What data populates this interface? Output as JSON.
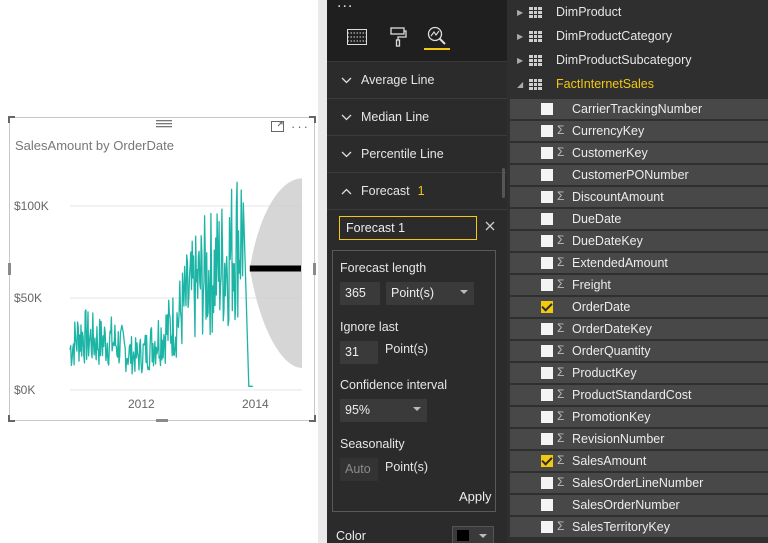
{
  "visual": {
    "title": "SalesAmount by OrderDate",
    "icons": [
      "focus-mode-icon",
      "more-options-icon"
    ]
  },
  "chart_data": {
    "type": "line",
    "title": "SalesAmount by OrderDate",
    "xlabel": "",
    "ylabel": "",
    "x_ticks": [
      "2012",
      "2014"
    ],
    "y_ticks": [
      "$0K",
      "$50K",
      "$100K"
    ],
    "ylim": [
      0,
      115000
    ],
    "series": [
      {
        "x": [
          "2011-01",
          "2011-03",
          "2011-05",
          "2011-07",
          "2011-09",
          "2011-11",
          "2012-01",
          "2012-03",
          "2012-05",
          "2012-07",
          "2012-09",
          "2012-11",
          "2013-01",
          "2013-03",
          "2013-05",
          "2013-07",
          "2013-09",
          "2013-11",
          "2014-01",
          "2014-02"
        ],
        "y": [
          22000,
          30000,
          28000,
          26000,
          27000,
          25000,
          20000,
          18000,
          22000,
          28000,
          32000,
          37000,
          48000,
          55000,
          62000,
          65000,
          70000,
          78000,
          90000,
          2000
        ]
      }
    ],
    "forecast": {
      "value": 66000,
      "confidence_upper": 115000,
      "confidence_lower": 12000
    },
    "colors": {
      "series": "#1cb5a5",
      "forecast": "#000000",
      "band": "#cfcfcf"
    }
  },
  "format_pane": {
    "more": "...",
    "tabs": [
      "fields-tab-icon",
      "format-paint-icon",
      "analytics-icon"
    ],
    "sections": [
      {
        "label": "Average Line"
      },
      {
        "label": "Median Line"
      },
      {
        "label": "Percentile Line"
      },
      {
        "label": "Forecast",
        "badge": "1"
      }
    ],
    "forecast": {
      "name": "Forecast 1",
      "length_label": "Forecast length",
      "length_value": "365",
      "length_unit": "Point(s)",
      "ignore_label": "Ignore last",
      "ignore_value": "31",
      "ignore_unit": "Point(s)",
      "ci_label": "Confidence interval",
      "ci_value": "95%",
      "seasonality_label": "Seasonality",
      "seasonality_value": "Auto",
      "seasonality_unit": "Point(s)",
      "apply": "Apply"
    },
    "color_label": "Color",
    "color_value": "#000000"
  },
  "fields_pane": {
    "tables": [
      {
        "name": "DimProduct"
      },
      {
        "name": "DimProductCategory"
      },
      {
        "name": "DimProductSubcategory"
      },
      {
        "name": "FactInternetSales"
      }
    ],
    "fields": [
      {
        "name": "CarrierTrackingNumber",
        "sigma": false,
        "checked": false
      },
      {
        "name": "CurrencyKey",
        "sigma": true,
        "checked": false
      },
      {
        "name": "CustomerKey",
        "sigma": true,
        "checked": false
      },
      {
        "name": "CustomerPONumber",
        "sigma": false,
        "checked": false
      },
      {
        "name": "DiscountAmount",
        "sigma": true,
        "checked": false
      },
      {
        "name": "DueDate",
        "sigma": false,
        "checked": false
      },
      {
        "name": "DueDateKey",
        "sigma": true,
        "checked": false
      },
      {
        "name": "ExtendedAmount",
        "sigma": true,
        "checked": false
      },
      {
        "name": "Freight",
        "sigma": true,
        "checked": false
      },
      {
        "name": "OrderDate",
        "sigma": false,
        "checked": true
      },
      {
        "name": "OrderDateKey",
        "sigma": true,
        "checked": false
      },
      {
        "name": "OrderQuantity",
        "sigma": true,
        "checked": false
      },
      {
        "name": "ProductKey",
        "sigma": true,
        "checked": false
      },
      {
        "name": "ProductStandardCost",
        "sigma": true,
        "checked": false
      },
      {
        "name": "PromotionKey",
        "sigma": true,
        "checked": false
      },
      {
        "name": "RevisionNumber",
        "sigma": true,
        "checked": false
      },
      {
        "name": "SalesAmount",
        "sigma": true,
        "checked": true
      },
      {
        "name": "SalesOrderLineNumber",
        "sigma": true,
        "checked": false
      },
      {
        "name": "SalesOrderNumber",
        "sigma": false,
        "checked": false
      },
      {
        "name": "SalesTerritoryKey",
        "sigma": true,
        "checked": false
      }
    ],
    "sigma_symbol": "Σ"
  }
}
